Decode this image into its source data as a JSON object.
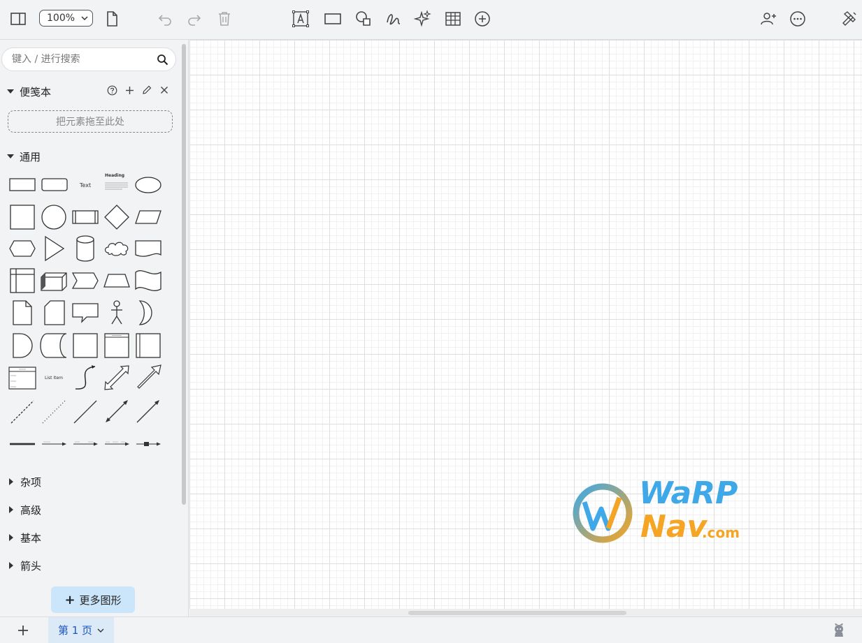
{
  "toolbar": {
    "zoom_value": "100%",
    "icons": [
      "format-panel-icon",
      "page-icon",
      "undo-icon",
      "redo-icon",
      "delete-icon",
      "text-icon",
      "rectangle-icon",
      "shapes-icon",
      "freehand-icon",
      "ai-sparkles-icon",
      "table-icon",
      "insert-icon",
      "share-icon",
      "more-icon",
      "tools-icon"
    ]
  },
  "sidebar": {
    "search_placeholder": "键入 / 进行搜索",
    "scratchpad_title": "便笺本",
    "drop_hint": "把元素拖至此处",
    "general_title": "通用",
    "shape_labels": {
      "text": "Text",
      "heading": "Heading",
      "list_item": "List Item"
    },
    "collapsed_sections": [
      "杂项",
      "高级",
      "基本",
      "箭头"
    ],
    "more_shapes_label": "更多图形"
  },
  "watermark": {
    "line1": "WaRP",
    "line2": "Nav",
    "suffix": ".com"
  },
  "colors": {
    "accent_blue": "#3ea8e8",
    "accent_orange": "#f5a523",
    "page_tab_bg": "#dce9f7",
    "page_tab_text": "#1a56c5",
    "more_button_bg": "#cbe6fb"
  },
  "bottom": {
    "page_tab_label": "第 1 页"
  }
}
